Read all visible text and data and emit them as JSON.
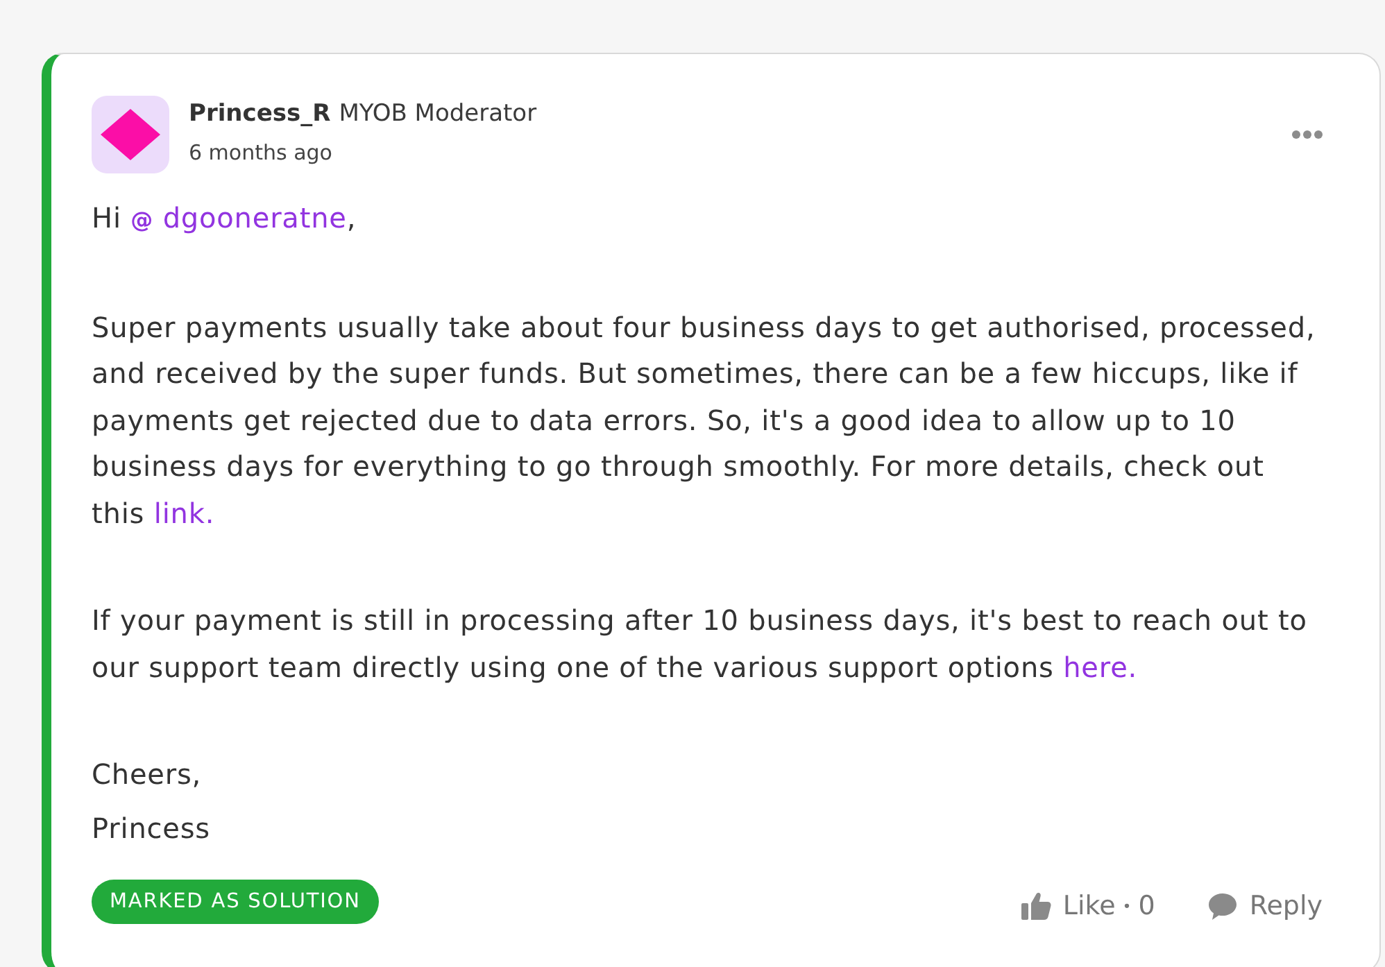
{
  "post": {
    "accepted": true,
    "author": {
      "name": "Princess_R",
      "role": "MYOB Moderator"
    },
    "timestamp": "6 months ago",
    "body": [
      {
        "segments": [
          {
            "kind": "text",
            "text": "Hi "
          },
          {
            "kind": "mention",
            "symbol": "@",
            "text": "dgooneratne"
          },
          {
            "kind": "text",
            "text": ","
          }
        ]
      },
      {
        "segments": [
          {
            "kind": "text",
            "text": "Super payments usually take about four business days to get authorised, processed, and received by the super funds. But sometimes, there can be a few hiccups, like if payments get rejected due to data errors. So, it's a good idea to allow up to 10 business days for everything to go through smoothly. For more details, check out this "
          },
          {
            "kind": "link",
            "text": "link."
          }
        ]
      },
      {
        "segments": [
          {
            "kind": "text",
            "text": "If your payment is still in processing after 10 business days, it's best to reach out to our support team directly using one of the various support options "
          },
          {
            "kind": "link",
            "text": "here."
          }
        ]
      }
    ],
    "signoff": {
      "closing": "Cheers,",
      "name": "Princess"
    },
    "solution_badge": "MARKED AS SOLUTION",
    "actions": {
      "like": {
        "label": "Like",
        "separator": "•",
        "count": "0"
      },
      "reply": {
        "label": "Reply"
      }
    }
  }
}
